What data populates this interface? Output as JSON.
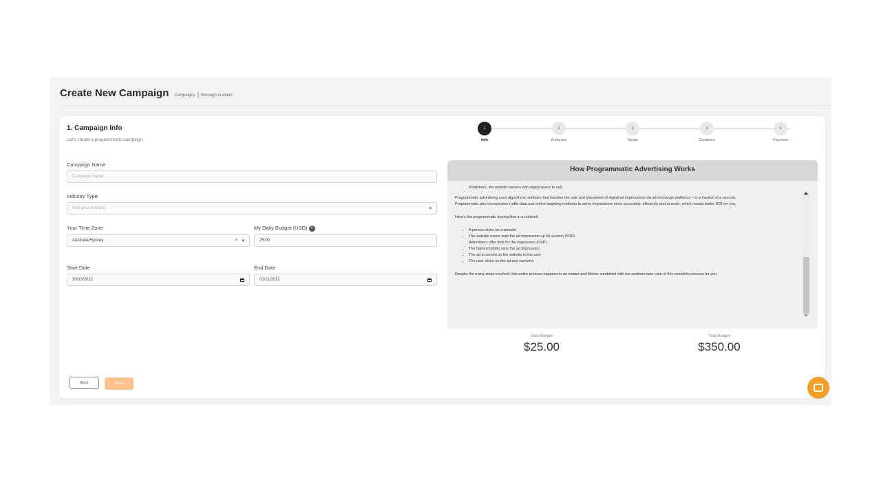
{
  "header": {
    "title": "Create New Campaign",
    "breadcrumb": [
      "Campaigns",
      "Borough markets"
    ]
  },
  "section": {
    "title": "1. Campaign Info",
    "subtitle": "Let's create a programmatic campaign."
  },
  "form": {
    "campaign_name": {
      "label": "Campaign Name",
      "placeholder": "Campaign Name"
    },
    "industry": {
      "label": "Industry Type",
      "placeholder": "Pick your Industry"
    },
    "timezone": {
      "label": "Your Time Zone",
      "value": "Australia/Sydney"
    },
    "daily_budget": {
      "label": "My Daily Budget (USD)",
      "value": "25.00"
    },
    "start_date": {
      "label": "Start Date",
      "value": "20/10/2022"
    },
    "end_date": {
      "label": "End Date",
      "value": "02/11/2022"
    }
  },
  "steps": [
    {
      "number": "1",
      "label": "Info",
      "active": true
    },
    {
      "number": "2",
      "label": "Audience",
      "active": false
    },
    {
      "number": "3",
      "label": "Target",
      "active": false
    },
    {
      "number": "4",
      "label": "Creatives",
      "active": false
    },
    {
      "number": "5",
      "label": "Payment",
      "active": false
    }
  ],
  "info_panel": {
    "title": "How Programmatic Advertising Works",
    "bullet_top": "Publishers, the website owners with digital space to sell.",
    "para1": "Programmatic advertising uses algorithmic software that handles the sale and placement of digital ad impressions via ad exchange platforms – in a fraction of a second.",
    "para2": "Programmatic also incorporates traffic data and online targeting methods to serve impressions more accurately, efficiently and at scale, which means better ROI for you.",
    "flow_intro": "Here's the programmatic buying flow in a nutshell:",
    "flow": [
      "A person clicks on a website",
      "The website owner puts the ad impression up for auction (SSP)",
      "Advertisers offer bids for the impression (DSP)",
      "The highest bidder wins the ad impression",
      "The ad is served on the website to the user",
      "The user clicks on the ad and converts"
    ],
    "closing": "Despite the many steps involved, this entire process happens in an instant and Mortar combined with our partners take care of this complete process for you."
  },
  "budget": {
    "daily_label": "Daily Budget",
    "daily_value": "$25.00",
    "total_label": "Total Budget",
    "total_value": "$350.00"
  },
  "buttons": {
    "back": "Back",
    "next": "Next"
  },
  "colors": {
    "accent": "#f0a028",
    "next_button": "#ffc38f",
    "active_step": "#222222"
  },
  "icons": {
    "chat": "chat-icon",
    "info": "info-icon",
    "calendar": "calendar-icon",
    "chevron": "chevron-down-icon",
    "clear": "clear-icon"
  }
}
